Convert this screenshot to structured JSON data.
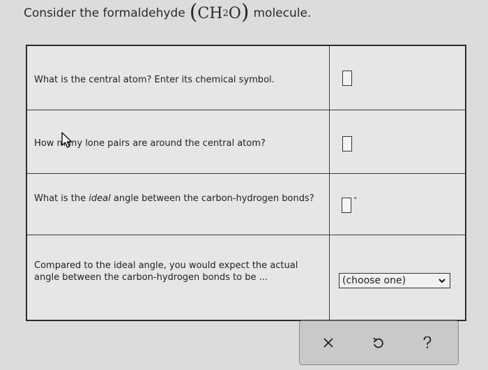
{
  "header": {
    "prefix": "Consider the formaldehyde",
    "formula_main": "CH",
    "formula_sub": "2",
    "formula_end": "O",
    "suffix": "molecule."
  },
  "questions": [
    {
      "text": "What is the central atom? Enter its chemical symbol."
    },
    {
      "text": "How many lone pairs are around the central atom?"
    },
    {
      "text_before": "What is the",
      "text_italic": "ideal",
      "text_after": "angle between the carbon-hydrogen bonds?",
      "unit": "°"
    },
    {
      "text": "Compared to the ideal angle, you would expect the actual angle between the carbon-hydrogen bonds to be ..."
    }
  ],
  "select": {
    "value": "(choose one)"
  },
  "toolbar": {
    "clear_icon": "close-icon",
    "undo_icon": "undo-icon",
    "help_icon": "help-icon"
  }
}
